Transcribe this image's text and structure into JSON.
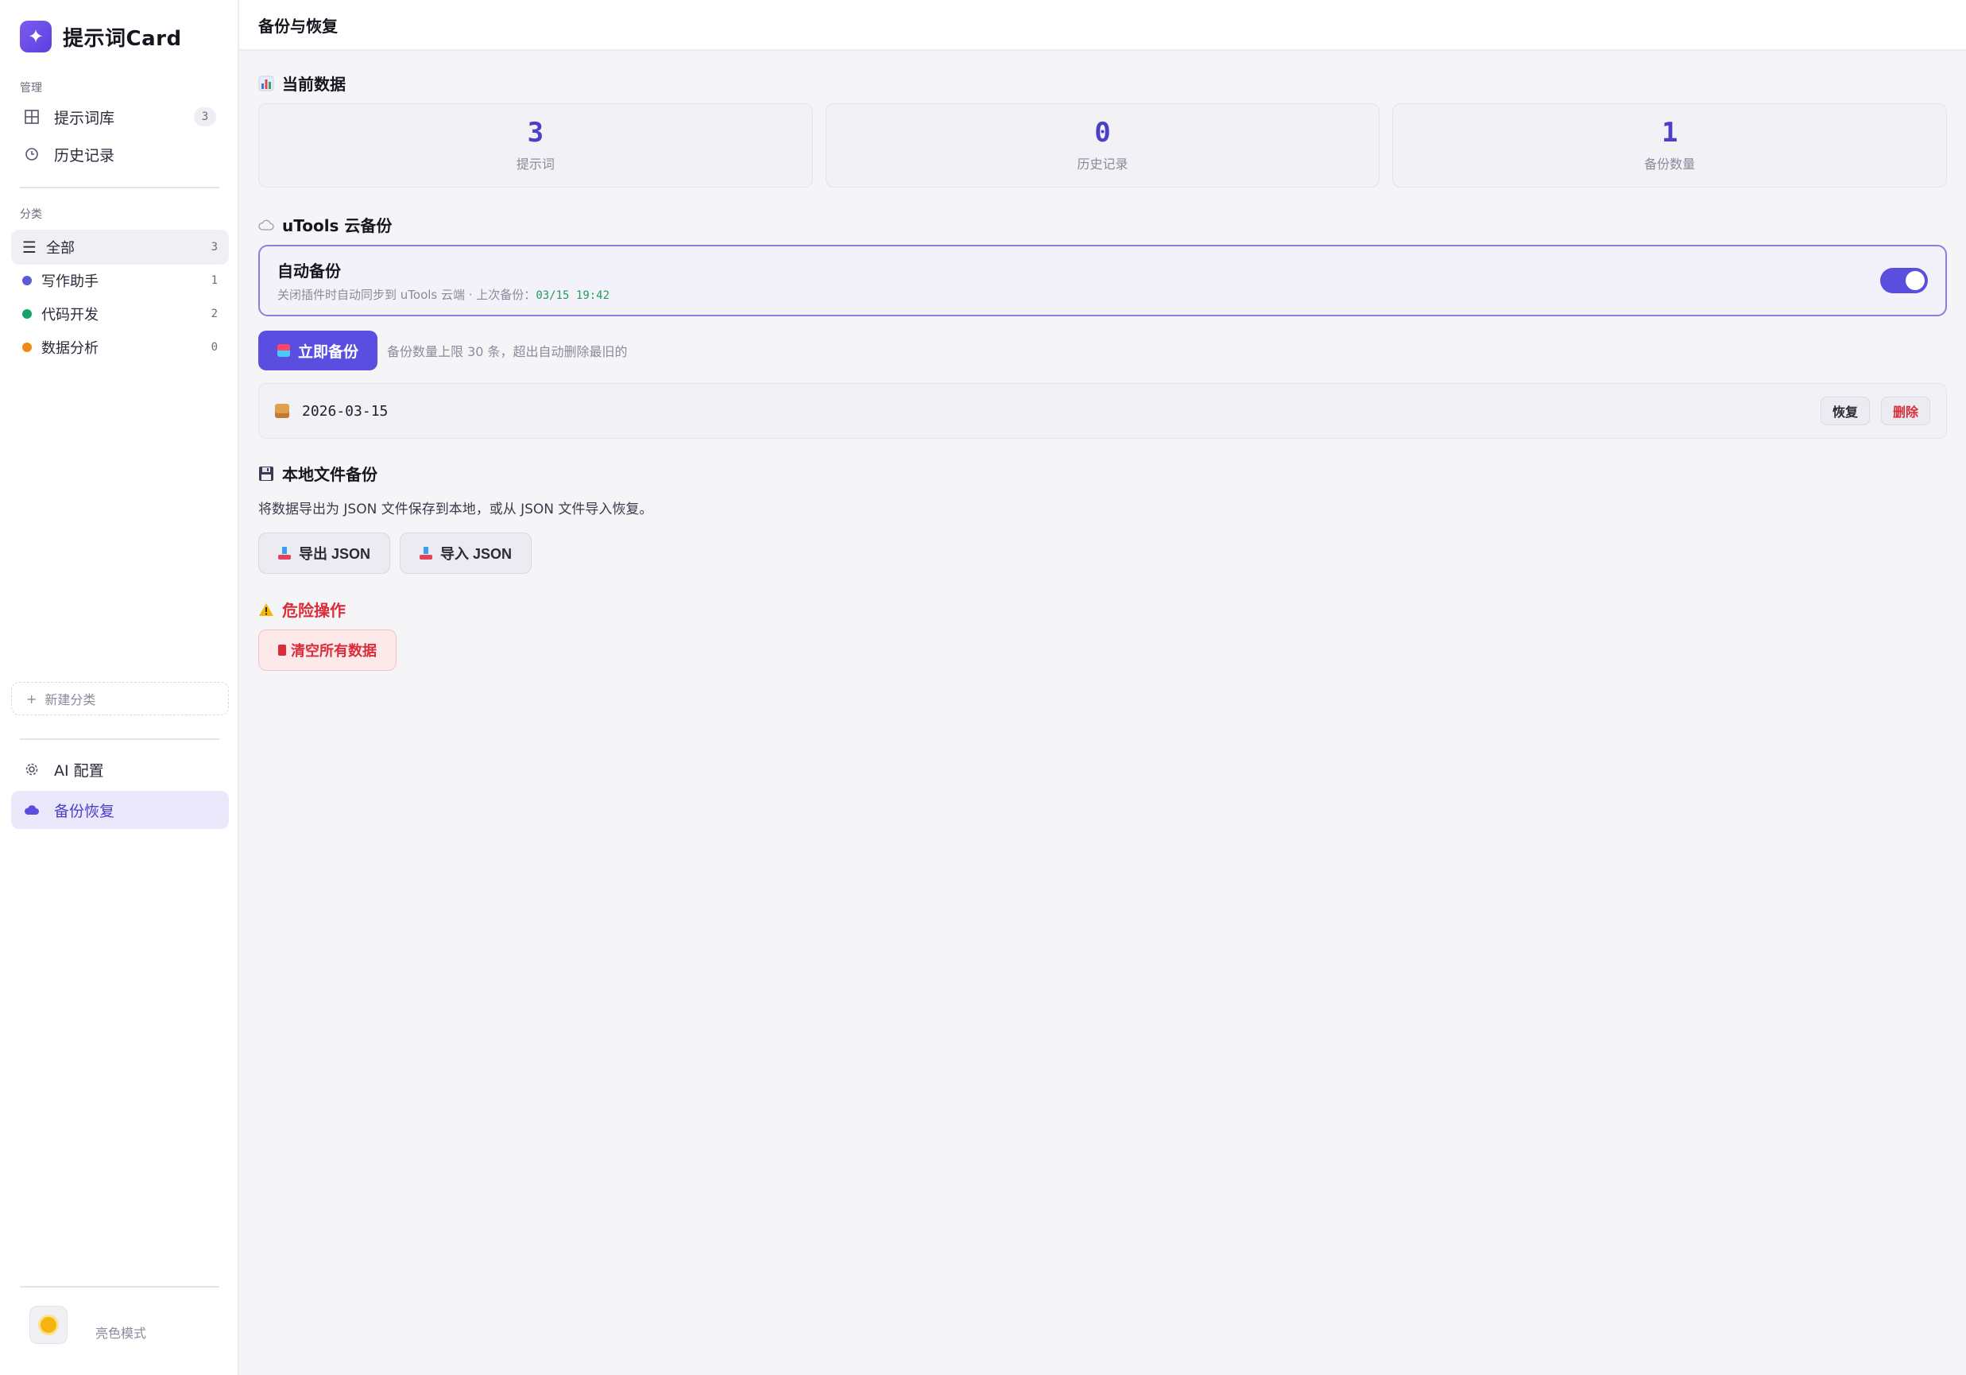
{
  "sidebar": {
    "brand": {
      "logo_glyph": "✦",
      "title": "提示词Card",
      "accent": "#6a4fe8"
    },
    "manage_label": "管理",
    "manage_items": [
      {
        "label": "提示词库",
        "icon": "grid-icon",
        "count": "3"
      },
      {
        "label": "历史记录",
        "icon": "clock-icon"
      }
    ],
    "category_label": "分类",
    "categories": [
      {
        "label": "全部",
        "count": "3",
        "icon": "list-icon"
      },
      {
        "label": "写作助手",
        "count": "1",
        "color": "#5b5bd6"
      },
      {
        "label": "代码开发",
        "count": "2",
        "color": "#16a36a"
      },
      {
        "label": "数据分析",
        "count": "0",
        "color": "#f08a12"
      }
    ],
    "new_category": "新建分类",
    "bottom_items": [
      {
        "label": "AI 配置",
        "icon": "gear-icon"
      },
      {
        "label": "备份恢复",
        "icon": "cloud-icon"
      }
    ],
    "theme_label": "亮色模式"
  },
  "header": {
    "title": "备份与恢复"
  },
  "current_data": {
    "title": "当前数据",
    "stats": [
      {
        "value": "3",
        "label": "提示词"
      },
      {
        "value": "0",
        "label": "历史记录"
      },
      {
        "value": "1",
        "label": "备份数量"
      }
    ]
  },
  "cloud": {
    "title": "uTools 云备份",
    "auto_title": "自动备份",
    "auto_desc": "关闭插件时自动同步到 uTools 云端 · 上次备份：",
    "last_time": "03/15 19:42",
    "auto_enabled": true,
    "backup_now": "立即备份",
    "limit_hint": "备份数量上限 30 条，超出自动删除最旧的",
    "backups": [
      {
        "date": "2026-03-15",
        "restore": "恢复",
        "delete": "删除"
      }
    ]
  },
  "local": {
    "title": "本地文件备份",
    "desc": "将数据导出为 JSON 文件保存到本地，或从 JSON 文件导入恢复。",
    "export": "导出 JSON",
    "import": "导入 JSON"
  },
  "danger": {
    "title": "危险操作",
    "clear_all": "清空所有数据",
    "color": "#d92d3a"
  }
}
